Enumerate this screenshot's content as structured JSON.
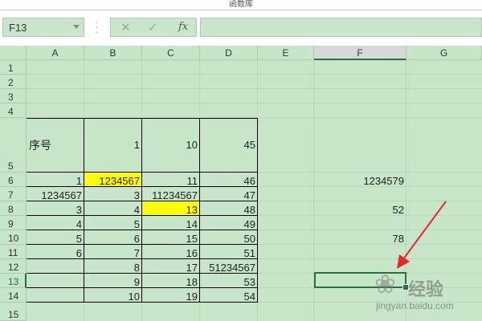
{
  "window": {
    "title": "函数库"
  },
  "formula_bar": {
    "name_box": "F13",
    "cancel_icon": "✕",
    "enter_icon": "✓",
    "fx_label": "fx",
    "formula": ""
  },
  "columns": [
    "A",
    "B",
    "C",
    "D",
    "E",
    "F",
    "G"
  ],
  "rows": [
    "1",
    "2",
    "3",
    "4",
    "5",
    "6",
    "7",
    "8",
    "9",
    "10",
    "11",
    "12",
    "13",
    "14",
    "15"
  ],
  "selected_cell": "F13",
  "table": {
    "header": {
      "A": "序号",
      "B": "1",
      "C": "10",
      "D": "45"
    },
    "rows": [
      {
        "A": "1",
        "B": "1234567",
        "C": "11",
        "D": "46"
      },
      {
        "A": "1234567",
        "B": "3",
        "C": "11234567",
        "D": "47"
      },
      {
        "A": "3",
        "B": "4",
        "C": "13",
        "D": "48"
      },
      {
        "A": "4",
        "B": "5",
        "C": "14",
        "D": "49"
      },
      {
        "A": "5",
        "B": "6",
        "C": "15",
        "D": "50"
      },
      {
        "A": "6",
        "B": "7",
        "C": "16",
        "D": "51"
      },
      {
        "A": "",
        "B": "8",
        "C": "17",
        "D": "51234567"
      },
      {
        "A": "",
        "B": "9",
        "C": "18",
        "D": "53"
      },
      {
        "A": "",
        "B": "10",
        "C": "19",
        "D": "54"
      }
    ]
  },
  "f_column": {
    "F6": "1234579",
    "F8": "52",
    "F10": "78"
  },
  "highlight_color": "#ffff00",
  "selection_color": "#217346",
  "annotation_arrow_color": "#e8262a",
  "watermark": {
    "brand": "经验",
    "url": "jingyan.baidu.com"
  }
}
